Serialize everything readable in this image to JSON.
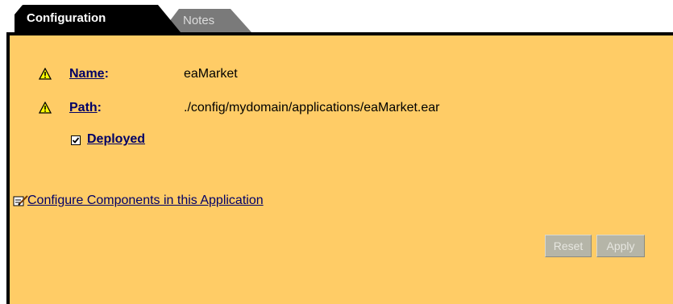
{
  "tabs": {
    "active": "Configuration",
    "inactive": "Notes"
  },
  "fields": {
    "name_label": "Name",
    "name_colon": ":",
    "name_value": "eaMarket",
    "path_label": "Path",
    "path_colon": ":",
    "path_value": "./config/mydomain/applications/eaMarket.ear",
    "deployed_label": "Deployed",
    "deployed_checked": true
  },
  "links": {
    "configure": "Configure Components in this Application"
  },
  "buttons": {
    "reset": "Reset",
    "apply": "Apply"
  },
  "colors": {
    "panel": "#ffcc66",
    "link": "#000066",
    "tab_active": "#000000",
    "tab_inactive": "#7a7a7a"
  },
  "icons": [
    "warning-icon",
    "checkbox-icon",
    "edit-icon"
  ]
}
